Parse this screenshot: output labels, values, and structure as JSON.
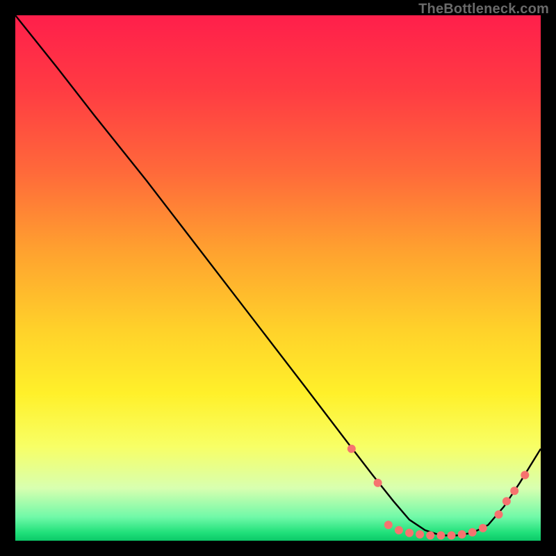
{
  "watermark": "TheBottleneck.com",
  "chart_data": {
    "type": "line",
    "title": "",
    "xlabel": "",
    "ylabel": "",
    "xlim": [
      0,
      100
    ],
    "ylim": [
      0,
      100
    ],
    "background_gradient": {
      "stops": [
        {
          "offset": 0.0,
          "color": "#ff1f4b"
        },
        {
          "offset": 0.14,
          "color": "#ff3b43"
        },
        {
          "offset": 0.3,
          "color": "#ff6a3a"
        },
        {
          "offset": 0.45,
          "color": "#ffa22f"
        },
        {
          "offset": 0.6,
          "color": "#ffd22a"
        },
        {
          "offset": 0.72,
          "color": "#fff02a"
        },
        {
          "offset": 0.82,
          "color": "#f8ff65"
        },
        {
          "offset": 0.9,
          "color": "#d8ffb0"
        },
        {
          "offset": 0.955,
          "color": "#70f9a8"
        },
        {
          "offset": 0.985,
          "color": "#1fe07a"
        },
        {
          "offset": 1.0,
          "color": "#0cc968"
        }
      ]
    },
    "series": [
      {
        "name": "bottleneck-curve",
        "color": "#000000",
        "x": [
          0.0,
          4.0,
          8.0,
          15.0,
          25.0,
          35.0,
          45.0,
          55.0,
          63.0,
          68.0,
          72.0,
          75.0,
          78.0,
          81.0,
          84.0,
          87.0,
          90.0,
          93.0,
          96.0,
          100.0
        ],
        "y": [
          100.0,
          95.0,
          90.0,
          81.0,
          68.5,
          55.5,
          42.5,
          29.5,
          19.0,
          12.5,
          7.5,
          4.0,
          2.0,
          1.0,
          1.0,
          1.5,
          3.0,
          6.5,
          11.0,
          17.5
        ]
      }
    ],
    "markers": {
      "name": "highlight-dots",
      "color": "#f6736f",
      "radius": 6,
      "points": [
        {
          "x": 64.0,
          "y": 17.5
        },
        {
          "x": 69.0,
          "y": 11.0
        },
        {
          "x": 71.0,
          "y": 3.0
        },
        {
          "x": 73.0,
          "y": 2.0
        },
        {
          "x": 75.0,
          "y": 1.5
        },
        {
          "x": 77.0,
          "y": 1.2
        },
        {
          "x": 79.0,
          "y": 1.0
        },
        {
          "x": 81.0,
          "y": 1.0
        },
        {
          "x": 83.0,
          "y": 1.0
        },
        {
          "x": 85.0,
          "y": 1.2
        },
        {
          "x": 87.0,
          "y": 1.6
        },
        {
          "x": 89.0,
          "y": 2.4
        },
        {
          "x": 92.0,
          "y": 5.0
        },
        {
          "x": 93.5,
          "y": 7.5
        },
        {
          "x": 95.0,
          "y": 9.5
        },
        {
          "x": 97.0,
          "y": 12.5
        }
      ]
    }
  }
}
